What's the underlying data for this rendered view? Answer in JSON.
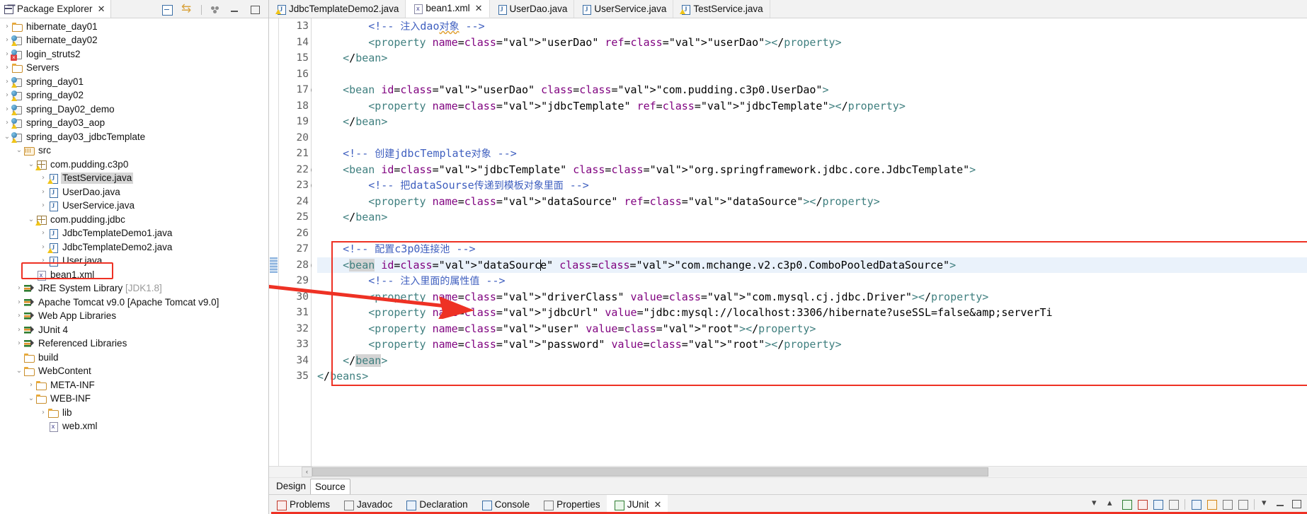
{
  "explorer": {
    "title": "Package Explorer",
    "close_label": "✕",
    "toolbar": [
      {
        "name": "collapse-all",
        "label": "Collapse All"
      },
      {
        "name": "link-with-editor",
        "label": "Link with Editor"
      },
      {
        "name": "view-menu",
        "label": "View Menu"
      },
      {
        "name": "minimize",
        "label": "Minimize"
      },
      {
        "name": "maximize",
        "label": "Maximize"
      }
    ],
    "tree": [
      {
        "label": "hibernate_day01",
        "indent": 0,
        "arrow": "›",
        "icon": "project-folder",
        "selected": false,
        "badge": "none"
      },
      {
        "label": "hibernate_day02",
        "indent": 0,
        "arrow": "›",
        "icon": "project-web",
        "selected": false,
        "badge": "warning"
      },
      {
        "label": "login_struts2",
        "indent": 0,
        "arrow": "›",
        "icon": "project-web",
        "selected": false,
        "badge": "error"
      },
      {
        "label": "Servers",
        "indent": 0,
        "arrow": "›",
        "icon": "folder",
        "selected": false,
        "badge": "none"
      },
      {
        "label": "spring_day01",
        "indent": 0,
        "arrow": "›",
        "icon": "project-web",
        "selected": false,
        "badge": "warning"
      },
      {
        "label": "spring_day02",
        "indent": 0,
        "arrow": "›",
        "icon": "project-web",
        "selected": false,
        "badge": "warning"
      },
      {
        "label": "spring_Day02_demo",
        "indent": 0,
        "arrow": "›",
        "icon": "project-web",
        "selected": false,
        "badge": "warning"
      },
      {
        "label": "spring_day03_aop",
        "indent": 0,
        "arrow": "›",
        "icon": "project-web",
        "selected": false,
        "badge": "warning"
      },
      {
        "label": "spring_day03_jdbcTemplate",
        "indent": 0,
        "arrow": "⌄",
        "icon": "project-web",
        "selected": false,
        "badge": "warning"
      },
      {
        "label": "src",
        "indent": 1,
        "arrow": "⌄",
        "icon": "source-folder",
        "selected": false,
        "badge": "none"
      },
      {
        "label": "com.pudding.c3p0",
        "indent": 2,
        "arrow": "⌄",
        "icon": "package",
        "selected": false,
        "badge": "warning"
      },
      {
        "label": "TestService.java",
        "indent": 3,
        "arrow": "›",
        "icon": "java-file",
        "selected": true,
        "badge": "warning"
      },
      {
        "label": "UserDao.java",
        "indent": 3,
        "arrow": "›",
        "icon": "java-file",
        "selected": false,
        "badge": "none"
      },
      {
        "label": "UserService.java",
        "indent": 3,
        "arrow": "›",
        "icon": "java-file",
        "selected": false,
        "badge": "none"
      },
      {
        "label": "com.pudding.jdbc",
        "indent": 2,
        "arrow": "⌄",
        "icon": "package",
        "selected": false,
        "badge": "warning"
      },
      {
        "label": "JdbcTemplateDemo1.java",
        "indent": 3,
        "arrow": "›",
        "icon": "java-file",
        "selected": false,
        "badge": "none"
      },
      {
        "label": "JdbcTemplateDemo2.java",
        "indent": 3,
        "arrow": "›",
        "icon": "java-file",
        "selected": false,
        "badge": "warning"
      },
      {
        "label": "User.java",
        "indent": 3,
        "arrow": "›",
        "icon": "java-file",
        "selected": false,
        "badge": "none"
      },
      {
        "label": "bean1.xml",
        "indent": 2,
        "arrow": "",
        "icon": "xml-file",
        "selected": false,
        "badge": "none"
      },
      {
        "label": "JRE System Library",
        "suffix": " [JDK1.8]",
        "indent": 1,
        "arrow": "›",
        "icon": "library",
        "selected": false,
        "badge": "none"
      },
      {
        "label": "Apache Tomcat v9.0 [Apache Tomcat v9.0]",
        "indent": 1,
        "arrow": "›",
        "icon": "library",
        "selected": false,
        "badge": "none"
      },
      {
        "label": "Web App Libraries",
        "indent": 1,
        "arrow": "›",
        "icon": "library",
        "selected": false,
        "badge": "none"
      },
      {
        "label": "JUnit 4",
        "indent": 1,
        "arrow": "›",
        "icon": "library",
        "selected": false,
        "badge": "none"
      },
      {
        "label": "Referenced Libraries",
        "indent": 1,
        "arrow": "›",
        "icon": "library",
        "selected": false,
        "badge": "none"
      },
      {
        "label": "build",
        "indent": 1,
        "arrow": "",
        "icon": "folder",
        "selected": false,
        "badge": "none"
      },
      {
        "label": "WebContent",
        "indent": 1,
        "arrow": "⌄",
        "icon": "folder",
        "selected": false,
        "badge": "none"
      },
      {
        "label": "META-INF",
        "indent": 2,
        "arrow": "›",
        "icon": "folder",
        "selected": false,
        "badge": "none"
      },
      {
        "label": "WEB-INF",
        "indent": 2,
        "arrow": "⌄",
        "icon": "folder",
        "selected": false,
        "badge": "none"
      },
      {
        "label": "lib",
        "indent": 3,
        "arrow": "›",
        "icon": "folder",
        "selected": false,
        "badge": "none"
      },
      {
        "label": "web.xml",
        "indent": 3,
        "arrow": "",
        "icon": "xml-file",
        "selected": false,
        "badge": "none"
      }
    ]
  },
  "editor": {
    "tabs": [
      {
        "label": "JdbcTemplateDemo2.java",
        "icon": "java-warning-file",
        "active": false,
        "closable": false
      },
      {
        "label": "bean1.xml",
        "icon": "xml-file",
        "active": true,
        "closable": true,
        "close_label": "✕"
      },
      {
        "label": "UserDao.java",
        "icon": "java-file",
        "active": false,
        "closable": false
      },
      {
        "label": "UserService.java",
        "icon": "java-file",
        "active": false,
        "closable": false
      },
      {
        "label": "TestService.java",
        "icon": "java-warning-file",
        "active": false,
        "closable": false
      }
    ],
    "first_line_number": 13,
    "lines": [
      {
        "n": 13,
        "fold": false,
        "current": false
      },
      {
        "n": 14,
        "fold": false,
        "current": false
      },
      {
        "n": 15,
        "fold": false,
        "current": false
      },
      {
        "n": 16,
        "fold": false,
        "current": false
      },
      {
        "n": 17,
        "fold": true,
        "current": false
      },
      {
        "n": 18,
        "fold": false,
        "current": false
      },
      {
        "n": 19,
        "fold": false,
        "current": false
      },
      {
        "n": 20,
        "fold": false,
        "current": false
      },
      {
        "n": 21,
        "fold": false,
        "current": false
      },
      {
        "n": 22,
        "fold": true,
        "current": false
      },
      {
        "n": 23,
        "fold": true,
        "current": false
      },
      {
        "n": 24,
        "fold": false,
        "current": false
      },
      {
        "n": 25,
        "fold": false,
        "current": false
      },
      {
        "n": 26,
        "fold": false,
        "current": false
      },
      {
        "n": 27,
        "fold": false,
        "current": false
      },
      {
        "n": 28,
        "fold": true,
        "current": true
      },
      {
        "n": 29,
        "fold": false,
        "current": false
      },
      {
        "n": 30,
        "fold": false,
        "current": false
      },
      {
        "n": 31,
        "fold": false,
        "current": false
      },
      {
        "n": 32,
        "fold": false,
        "current": false
      },
      {
        "n": 33,
        "fold": false,
        "current": false
      },
      {
        "n": 34,
        "fold": false,
        "current": false
      },
      {
        "n": 35,
        "fold": false,
        "current": false
      }
    ],
    "source_text": {
      "l13": "        <!-- 注入dao对象 -->",
      "l14": "        <property name=\"userDao\" ref=\"userDao\"></property>",
      "l15": "    </bean>",
      "l16": "",
      "l17": "    <bean id=\"userDao\" class=\"com.pudding.c3p0.UserDao\">",
      "l18": "        <property name=\"jdbcTemplate\" ref=\"jdbcTemplate\"></property>",
      "l19": "    </bean>",
      "l20": "",
      "l21": "    <!-- 创建jdbcTemplate对象 -->",
      "l22": "    <bean id=\"jdbcTemplate\" class=\"org.springframework.jdbc.core.JdbcTemplate\">",
      "l23": "        <!-- 把dataSourse传递到模板对象里面 -->",
      "l24": "        <property name=\"dataSource\" ref=\"dataSource\"></property>",
      "l25": "    </bean>",
      "l26": "",
      "l27": "    <!-- 配置c3p0连接池 -->",
      "l28": "    <bean id=\"dataSource\" class=\"com.mchange.v2.c3p0.ComboPooledDataSource\">",
      "l29": "        <!-- 注入里面的属性值 -->",
      "l30": "        <property name=\"driverClass\" value=\"com.mysql.cj.jdbc.Driver\"></property>",
      "l31": "        <property name=\"jdbcUrl\" value=\"jdbc:mysql://localhost:3306/hibernate?useSSL=false&amp;serverTi",
      "l32": "        <property name=\"user\" value=\"root\"></property>",
      "l33": "        <property name=\"password\" value=\"root\"></property>",
      "l34": "    </bean>",
      "l35": "</beans>"
    },
    "bottom_tabs": [
      {
        "label": "Design",
        "active": false
      },
      {
        "label": "Source",
        "active": true
      }
    ],
    "hscroll_left_label": "‹"
  },
  "views_bar": {
    "tabs": [
      {
        "label": "Problems",
        "icon": "problems-icon",
        "active": false,
        "closable": false
      },
      {
        "label": "Javadoc",
        "icon": "javadoc-icon",
        "active": false,
        "closable": false
      },
      {
        "label": "Declaration",
        "icon": "declaration-icon",
        "active": false,
        "closable": false
      },
      {
        "label": "Console",
        "icon": "console-icon",
        "active": false,
        "closable": false
      },
      {
        "label": "Properties",
        "icon": "properties-icon",
        "active": false,
        "closable": false
      },
      {
        "label": "JUnit",
        "icon": "junit-icon",
        "active": true,
        "closable": true,
        "close_label": "✕"
      }
    ],
    "toolbar_icons": [
      "sort-down-icon",
      "sort-up-icon",
      "junit-run-icon",
      "history-icon",
      "monitor-icon",
      "list-icon",
      "search-icon",
      "filter-icon",
      "pin-icon",
      "panel-icon",
      "view-menu-icon",
      "minimize-icon",
      "maximize-icon"
    ]
  },
  "annotations": {
    "highlight_color": "#ee3124",
    "explorer_box_target": "bean1.xml",
    "code_box_target": "c3p0 dataSource bean block (lines 27-34)",
    "arrow_label": "pointer from bean1.xml to dataSource bean"
  }
}
